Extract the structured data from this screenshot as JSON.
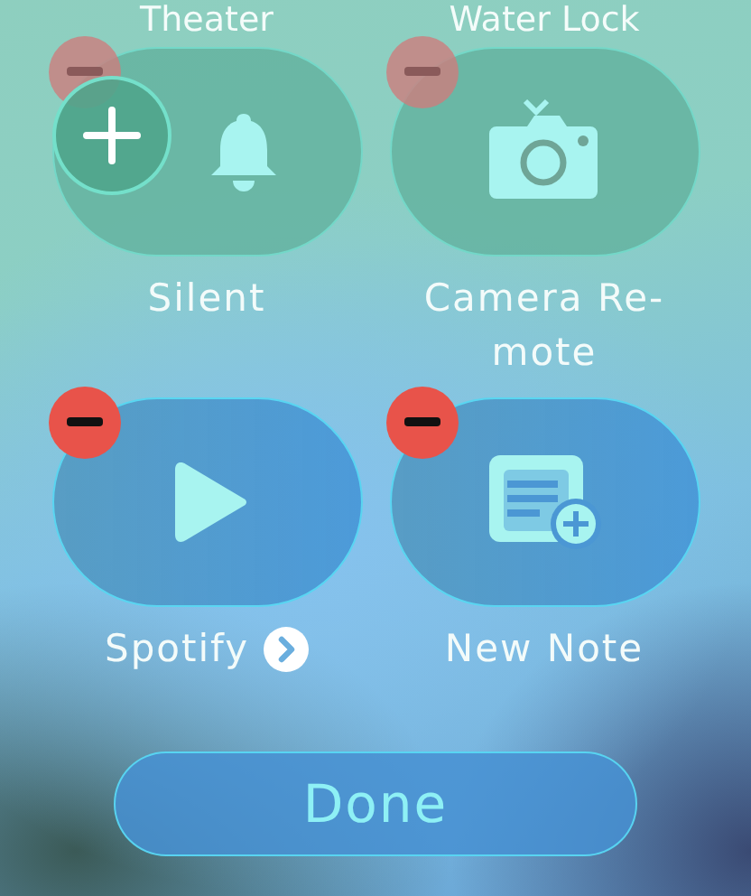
{
  "header_labels": [
    "Theater",
    "Water Lock"
  ],
  "tiles": [
    {
      "label": "Silent",
      "kind": "bell",
      "faded": true,
      "adding": true,
      "chevron": false
    },
    {
      "label": "Camera Re-\nmote",
      "kind": "camera",
      "faded": true,
      "adding": false,
      "chevron": false
    },
    {
      "label": "Spotify",
      "kind": "play",
      "faded": false,
      "adding": false,
      "chevron": true
    },
    {
      "label": "New Note",
      "kind": "note",
      "faded": false,
      "adding": false,
      "chevron": false
    }
  ],
  "done_button": "Done"
}
